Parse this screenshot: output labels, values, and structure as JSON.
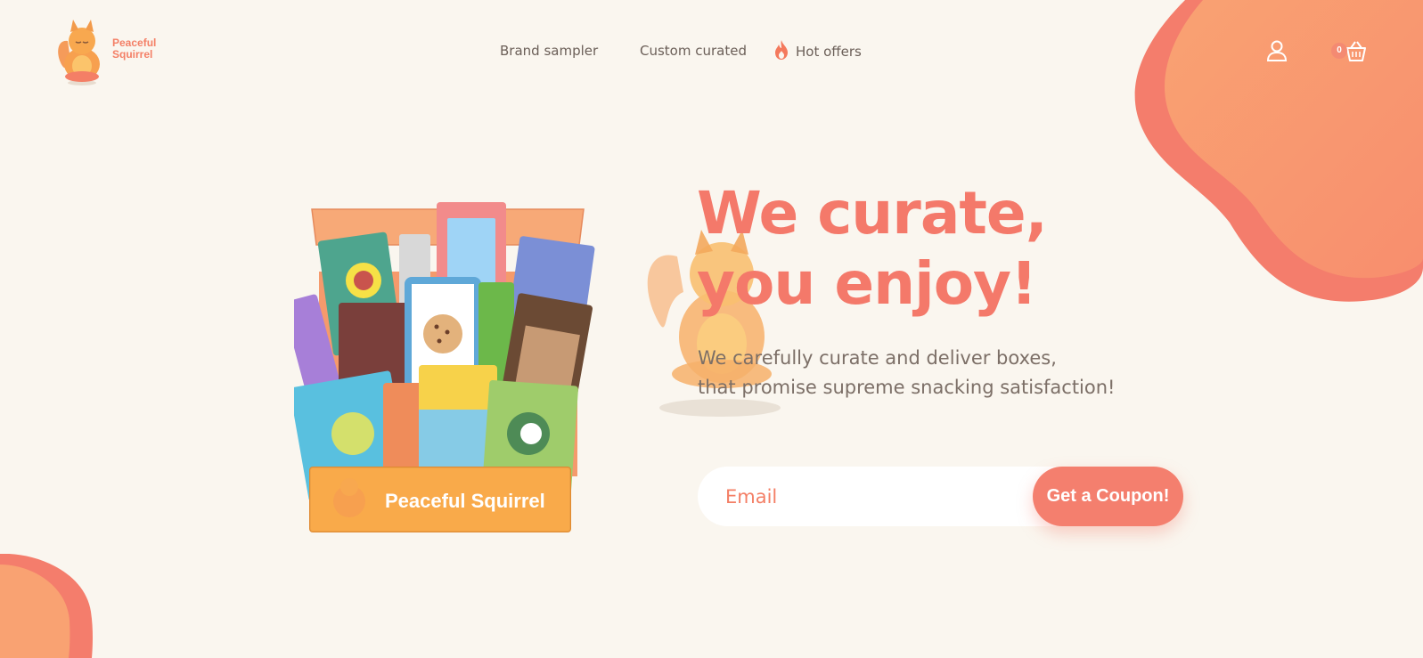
{
  "brand": {
    "name_line1": "Peaceful",
    "name_line2": "Squirrel",
    "box_label": "Peaceful Squirrel"
  },
  "nav": {
    "items": [
      {
        "label": "Brand sampler"
      },
      {
        "label": "Custom curated"
      },
      {
        "label": "Hot offers",
        "icon": "flame-icon"
      }
    ]
  },
  "header_actions": {
    "account_icon": "user-icon",
    "cart_icon": "basket-icon",
    "cart_count": "0"
  },
  "hero": {
    "headline_line1": "We curate,",
    "headline_line2": "you enjoy!",
    "sub_line1": "We carefully curate and deliver boxes,",
    "sub_line2": "that promise supreme snacking satisfaction!",
    "email_placeholder": "Email",
    "cta_label": "Get a Coupon!"
  },
  "colors": {
    "background": "#faf6ef",
    "accent": "#f4796a",
    "accent_light": "#f9a272",
    "text_muted": "#7c6f67"
  }
}
